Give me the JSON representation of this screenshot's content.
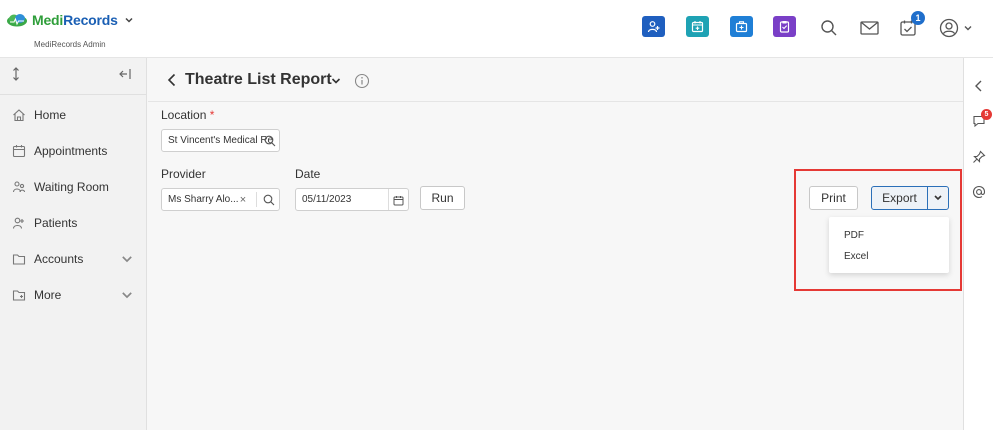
{
  "app": {
    "brand_part1": "Medi",
    "brand_part2": "Records",
    "subtitle": "MediRecords Admin"
  },
  "topbar": {
    "quick_buttons": [
      {
        "name": "add-patient-icon",
        "color": "#1f5fbf"
      },
      {
        "name": "calendar-icon",
        "color": "#1ea2b4"
      },
      {
        "name": "medical-kit-icon",
        "color": "#1f7fd6"
      },
      {
        "name": "clipboard-icon",
        "color": "#7a3fc7"
      }
    ],
    "notification_count": "1"
  },
  "sidebar": {
    "items": [
      {
        "label": "Home",
        "icon": "home-icon"
      },
      {
        "label": "Appointments",
        "icon": "calendar-icon"
      },
      {
        "label": "Waiting Room",
        "icon": "waiting-room-icon"
      },
      {
        "label": "Patients",
        "icon": "patients-icon"
      },
      {
        "label": "Accounts",
        "icon": "folder-icon",
        "expandable": true
      },
      {
        "label": "More",
        "icon": "folder-more-icon",
        "expandable": true
      }
    ]
  },
  "page": {
    "title": "Theatre List Report"
  },
  "form": {
    "location_label": "Location",
    "location_required": "*",
    "location_value": "St Vincent's Medical Re",
    "provider_label": "Provider",
    "provider_value": "Ms Sharry Alo...",
    "provider_clear": "×",
    "date_label": "Date",
    "date_value": "05/11/2023",
    "run_label": "Run"
  },
  "actions": {
    "print_label": "Print",
    "export_label": "Export",
    "export_options": [
      "PDF",
      "Excel"
    ]
  },
  "rail": {
    "chat_badge": "5"
  },
  "colors": {
    "highlight": "#e53935",
    "accent": "#2b6fb8"
  }
}
